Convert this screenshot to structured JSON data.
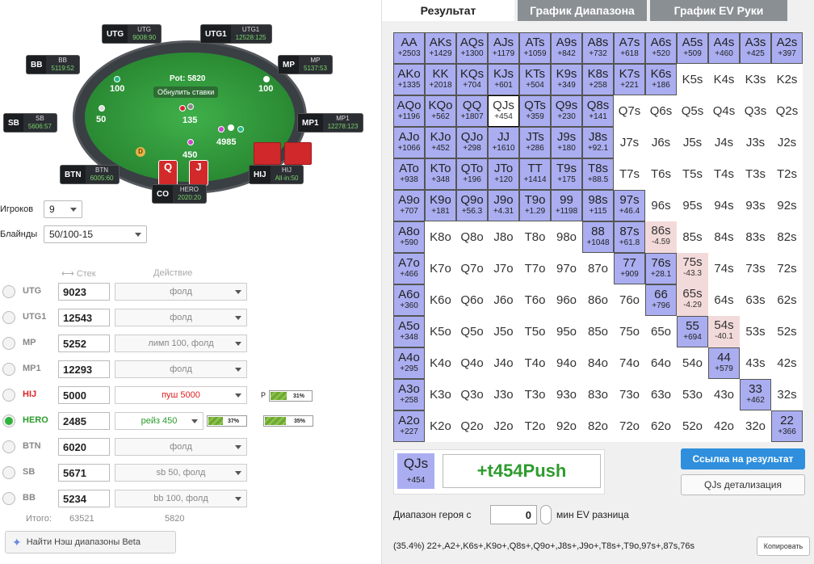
{
  "table": {
    "pot": "Pot: 5820",
    "reset_bets": "Обнулить ставки",
    "chips": {
      "utg": "100",
      "mp": "100",
      "sb": "50",
      "center": "135",
      "hero": "450",
      "bottom": "4985"
    },
    "seats": [
      {
        "pos": "UTG",
        "name": "UTG",
        "stack": "9008",
        "bb": "90"
      },
      {
        "pos": "UTG1",
        "name": "UTG1",
        "stack": "12528",
        "bb": "125"
      },
      {
        "pos": "BB",
        "name": "BB",
        "stack": "5119",
        "bb": "52"
      },
      {
        "pos": "MP",
        "name": "MP",
        "stack": "5137",
        "bb": "53"
      },
      {
        "pos": "SB",
        "name": "SB",
        "stack": "5606",
        "bb": "57"
      },
      {
        "pos": "MP1",
        "name": "MP1",
        "stack": "12278",
        "bb": "123"
      },
      {
        "pos": "BTN",
        "name": "BTN",
        "stack": "6005",
        "bb": "60"
      },
      {
        "pos": "HIJ",
        "name": "HIJ",
        "stack": "All-in",
        "bb": "50"
      },
      {
        "pos": "CO",
        "name": "HERO",
        "stack": "2020",
        "bb": "20"
      }
    ],
    "dealer": "D",
    "hero_cards": [
      "Q",
      "J"
    ]
  },
  "controls": {
    "players_label": "Игроков",
    "players_value": "9",
    "blinds_label": "Блайнды",
    "blinds_value": "50/100-15",
    "stack_header": "Стек",
    "action_header": "Действие"
  },
  "players": [
    {
      "name": "UTG",
      "stack": "9023",
      "action": "фолд",
      "color": "#888"
    },
    {
      "name": "UTG1",
      "stack": "12543",
      "action": "фолд",
      "color": "#888"
    },
    {
      "name": "MP",
      "stack": "5252",
      "action": "лимп 100, фолд",
      "color": "#888"
    },
    {
      "name": "MP1",
      "stack": "12293",
      "action": "фолд",
      "color": "#888"
    },
    {
      "name": "HIJ",
      "stack": "5000",
      "action": "пуш 5000",
      "color": "#d22"
    },
    {
      "name": "HERO",
      "stack": "2485",
      "action": "рейз 450",
      "color": "#2a9a2a"
    },
    {
      "name": "BTN",
      "stack": "6020",
      "action": "фолд",
      "color": "#888"
    },
    {
      "name": "SB",
      "stack": "5671",
      "action": "sb 50, фолд",
      "color": "#888"
    },
    {
      "name": "BB",
      "stack": "5234",
      "action": "bb 100, фолд",
      "color": "#888"
    }
  ],
  "hero_eq": "37%",
  "eq_p_label": "P",
  "eq_p": "31%",
  "eq_total": "35%",
  "total": {
    "label": "Итого:",
    "stack": "63521",
    "action": "5820"
  },
  "nash_button": "Найти Нэш диапазоны Beta",
  "tabs": [
    "Результат",
    "График Диапазона",
    "График EV Руки"
  ],
  "grid": [
    [
      "AA|+2503|p",
      "AKs|+1429|p",
      "AQs|+1300|p",
      "AJs|+1179|p",
      "ATs|+1059|p",
      "A9s|+842|p",
      "A8s|+732|p",
      "A7s|+618|p",
      "A6s|+520|p",
      "A5s|+509|p",
      "A4s|+460|p",
      "A3s|+425|p",
      "A2s|+397|p"
    ],
    [
      "AKo|+1335|p",
      "KK|+2018|p",
      "KQs|+704|p",
      "KJs|+601|p",
      "KTs|+504|p",
      "K9s|+349|p",
      "K8s|+258|p",
      "K7s|+221|p",
      "K6s|+186|p",
      "K5s||",
      "K4s||",
      "K3s||",
      "K2s||"
    ],
    [
      "AQo|+1196|p",
      "KQo|+562|p",
      "QQ|+1807|p",
      "QJs|+454|s",
      "QTs|+359|p",
      "Q9s|+230|p",
      "Q8s|+141|p",
      "Q7s||",
      "Q6s||",
      "Q5s||",
      "Q4s||",
      "Q3s||",
      "Q2s||"
    ],
    [
      "AJo|+1066|p",
      "KJo|+452|p",
      "QJo|+298|p",
      "JJ|+1610|p",
      "JTs|+286|p",
      "J9s|+180|p",
      "J8s|+92.1|p",
      "J7s||",
      "J6s||",
      "J5s||",
      "J4s||",
      "J3s||",
      "J2s||"
    ],
    [
      "ATo|+938|p",
      "KTo|+348|p",
      "QTo|+196|p",
      "JTo|+120|p",
      "TT|+1414|p",
      "T9s|+175|p",
      "T8s|+88.5|p",
      "T7s||",
      "T6s||",
      "T5s||",
      "T4s||",
      "T3s||",
      "T2s||"
    ],
    [
      "A9o|+707|p",
      "K9o|+181|p",
      "Q9o|+56.3|p",
      "J9o|+4.31|p",
      "T9o|+1.29|p",
      "99|+1198|p",
      "98s|+115|p",
      "97s|+46.4|p",
      "96s||",
      "95s||",
      "94s||",
      "93s||",
      "92s||"
    ],
    [
      "A8o|+590|p",
      "K8o||",
      "Q8o||",
      "J8o||",
      "T8o||",
      "98o||",
      "88|+1048|p",
      "87s|+61.8|p",
      "86s|-4.59|n",
      "85s||",
      "84s||",
      "83s||",
      "82s||"
    ],
    [
      "A7o|+466|p",
      "K7o||",
      "Q7o||",
      "J7o||",
      "T7o||",
      "97o||",
      "87o||",
      "77|+909|p",
      "76s|+28.1|p",
      "75s|-43.3|n",
      "74s||",
      "73s||",
      "72s||"
    ],
    [
      "A6o|+360|p",
      "K6o||",
      "Q6o||",
      "J6o||",
      "T6o||",
      "96o||",
      "86o||",
      "76o||",
      "66|+796|p",
      "65s|-4.29|n",
      "64s||",
      "63s||",
      "62s||"
    ],
    [
      "A5o|+348|p",
      "K5o||",
      "Q5o||",
      "J5o||",
      "T5o||",
      "95o||",
      "85o||",
      "75o||",
      "65o||",
      "55|+694|p",
      "54s|-40.1|n",
      "53s||",
      "52s||"
    ],
    [
      "A4o|+295|p",
      "K4o||",
      "Q4o||",
      "J4o||",
      "T4o||",
      "94o||",
      "84o||",
      "74o||",
      "64o||",
      "54o||",
      "44|+579|p",
      "43s||",
      "42s||"
    ],
    [
      "A3o|+258|p",
      "K3o||",
      "Q3o||",
      "J3o||",
      "T3o||",
      "93o||",
      "83o||",
      "73o||",
      "63o||",
      "53o||",
      "43o||",
      "33|+462|p",
      "32s||"
    ],
    [
      "A2o|+227|p",
      "K2o||",
      "Q2o||",
      "J2o||",
      "T2o||",
      "92o||",
      "82o||",
      "72o||",
      "62o||",
      "52o||",
      "42o||",
      "32o||",
      "22|+366|p"
    ]
  ],
  "result": {
    "hand": "QJs",
    "ev": "+454",
    "text": "+t454Push"
  },
  "link_button": "Ссылка на результат",
  "detail_button": "QJs детализация",
  "range_label": "Диапазон героя с",
  "range_value": "0",
  "range_label2": "мин EV разница",
  "range_string": "(35.4%) 22+,A2+,K6s+,K9o+,Q8s+,Q9o+,J8s+,J9o+,T8s+,T9o,97s+,87s,76s",
  "copy_button": "Копировать",
  "colors": {
    "push": "#aaaef0",
    "negative": "#f3dada",
    "accent": "#2f8fdc",
    "ev_green": "#2e9b2e"
  }
}
